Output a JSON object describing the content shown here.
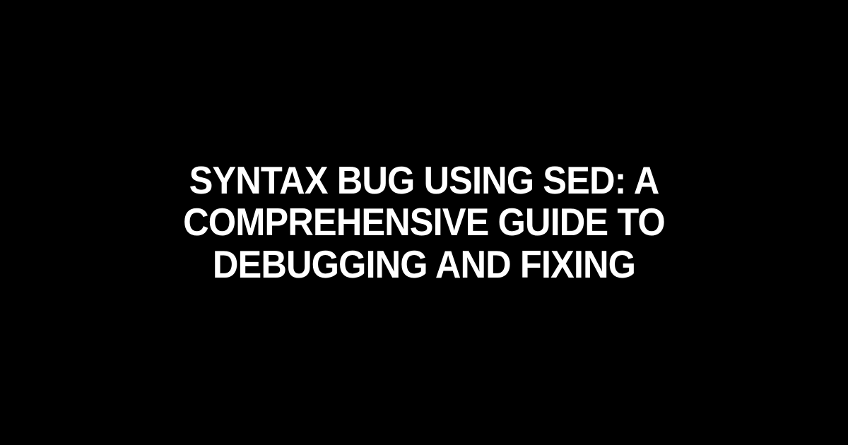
{
  "heading": {
    "title": "Syntax Bug using sed: A Comprehensive Guide to Debugging and Fixing"
  }
}
